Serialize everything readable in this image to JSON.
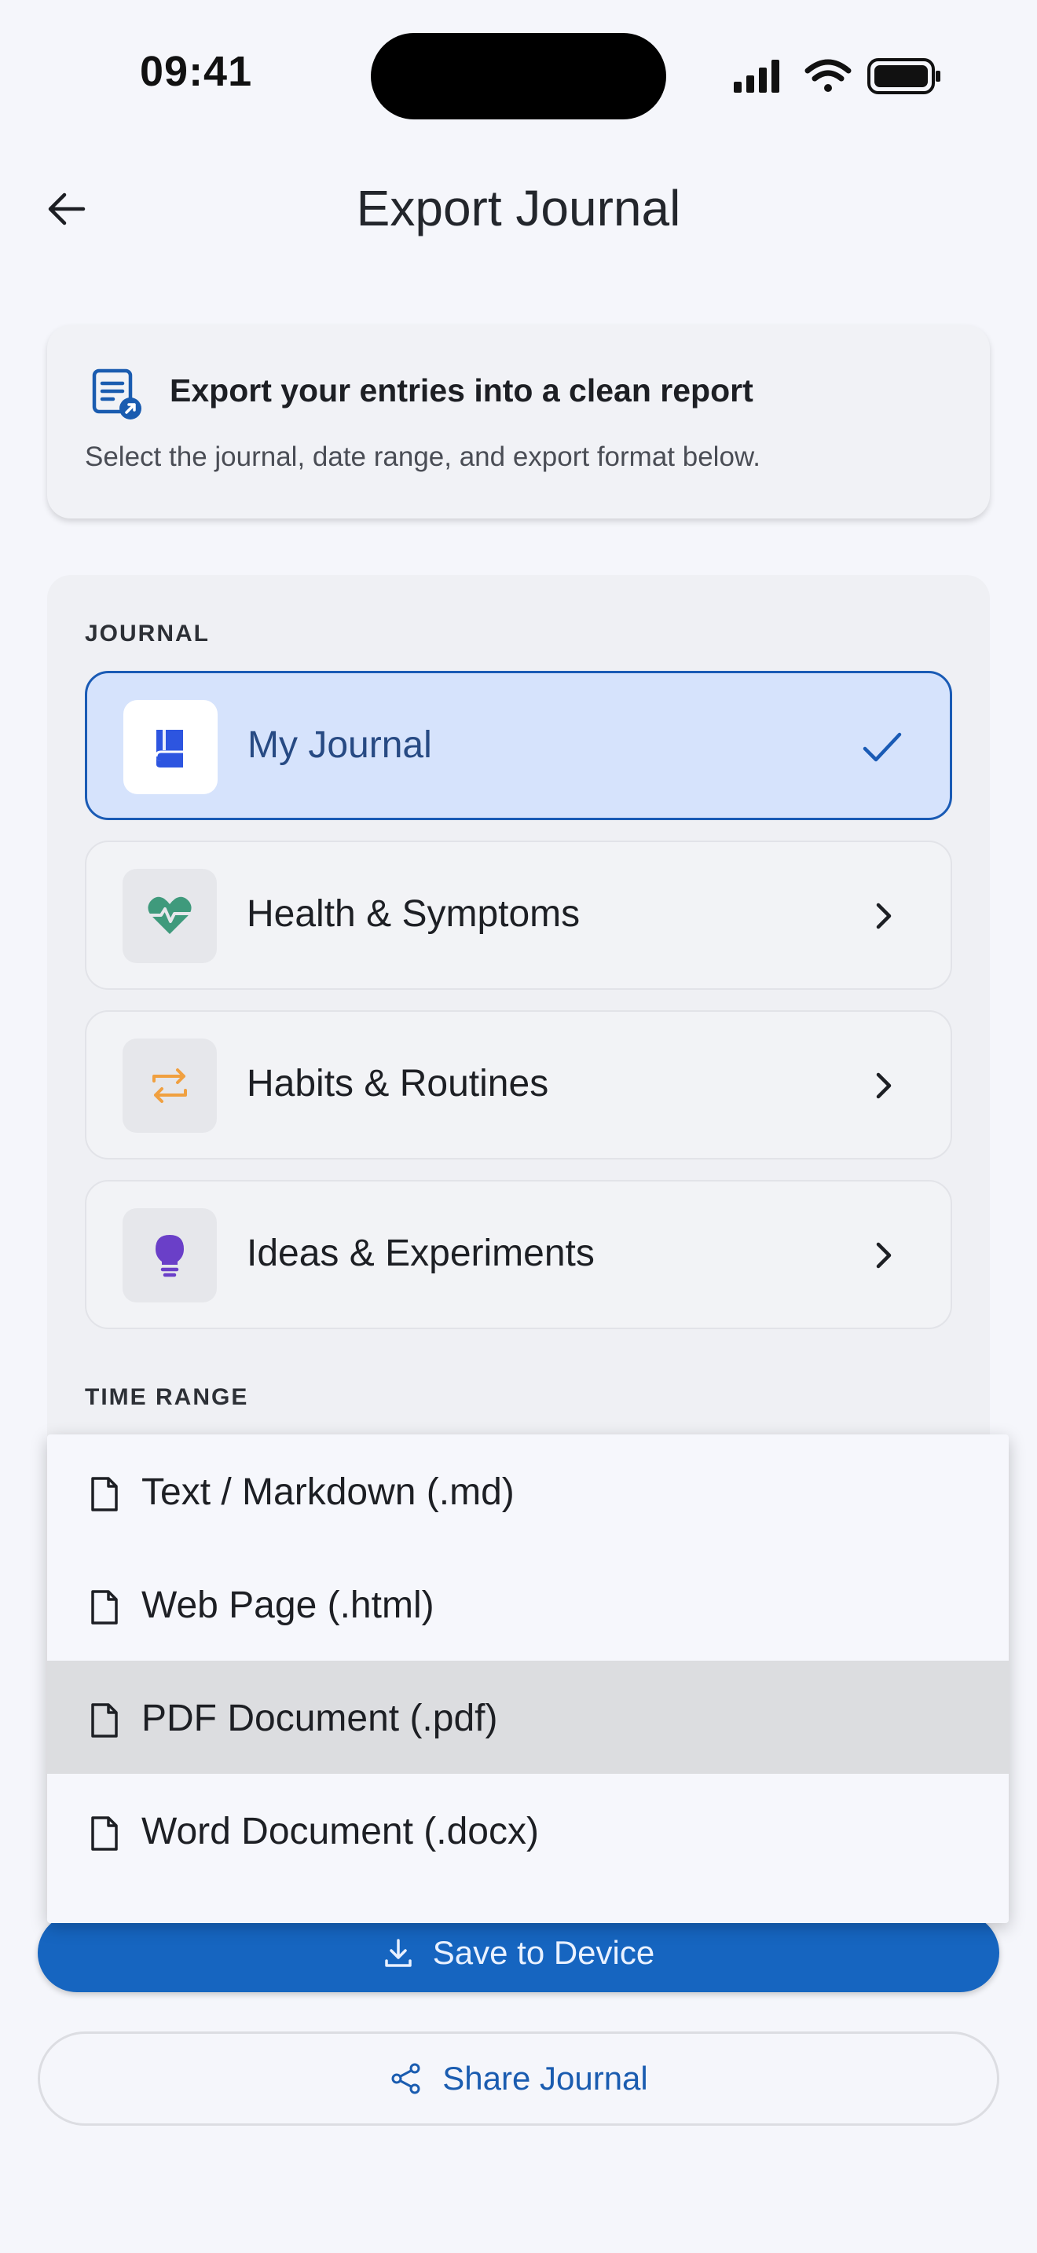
{
  "status_bar": {
    "time": "09:41"
  },
  "header": {
    "title": "Export Journal"
  },
  "info_card": {
    "title": "Export your entries into a clean report",
    "subtitle": "Select the journal, date range, and export format below."
  },
  "journal_section": {
    "label": "JOURNAL",
    "items": [
      {
        "label": "My Journal",
        "icon": "book-icon",
        "selected": true
      },
      {
        "label": "Health & Symptoms",
        "icon": "heart-pulse-icon",
        "selected": false
      },
      {
        "label": "Habits & Routines",
        "icon": "repeat-icon",
        "selected": false
      },
      {
        "label": "Ideas & Experiments",
        "icon": "lightbulb-icon",
        "selected": false
      }
    ]
  },
  "time_range_section": {
    "label": "TIME RANGE"
  },
  "format_menu": {
    "options": [
      {
        "label": "Text / Markdown (.md)",
        "highlighted": false
      },
      {
        "label": "Web Page (.html)",
        "highlighted": false
      },
      {
        "label": "PDF Document (.pdf)",
        "highlighted": true
      },
      {
        "label": "Word Document (.docx)",
        "highlighted": false
      }
    ]
  },
  "actions": {
    "save_label": "Save to Device",
    "share_label": "Share Journal"
  },
  "colors": {
    "primary": "#1665c0",
    "selected_bg": "#d6e3fc",
    "health_icon": "#3f9a7c",
    "habits_icon": "#f0a040",
    "ideas_icon": "#6a3fc8"
  }
}
